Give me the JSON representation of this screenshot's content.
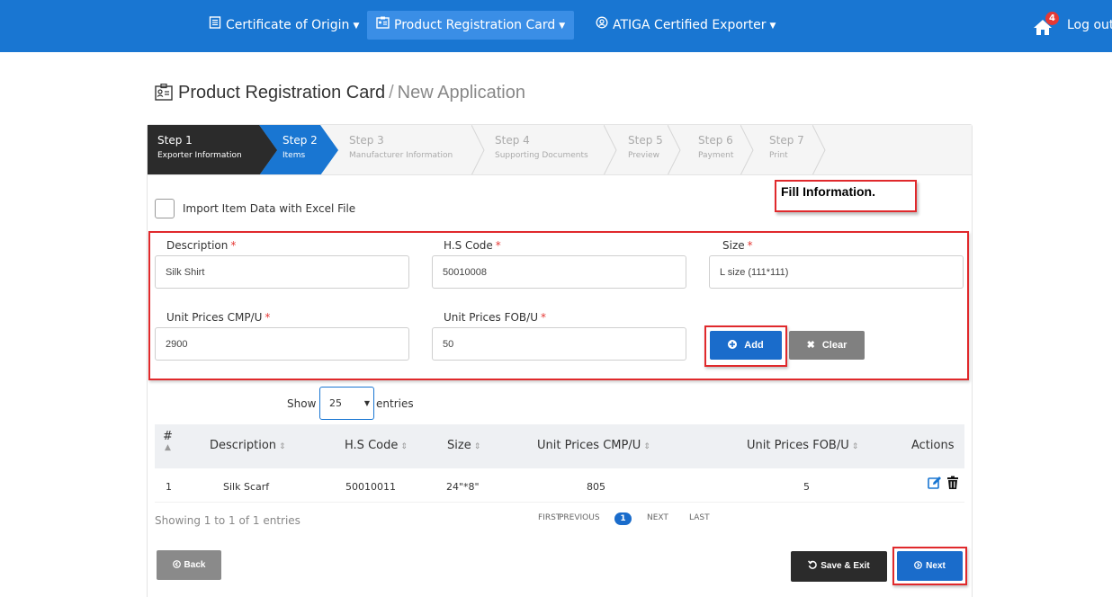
{
  "nav": {
    "certificate": "Certificate of Origin",
    "product_card": "Product Registration Card",
    "atiga": "ATIGA Certified Exporter",
    "notifications": "4",
    "logout": "Log out"
  },
  "page": {
    "title": "Product Registration Card",
    "separator": "/",
    "subtitle": "New Application"
  },
  "steps": [
    {
      "title": "Step 1",
      "sub": "Exporter Information",
      "state": "done"
    },
    {
      "title": "Step 2",
      "sub": "Items",
      "state": "current"
    },
    {
      "title": "Step 3",
      "sub": "Manufacturer Information",
      "state": "pending"
    },
    {
      "title": "Step 4",
      "sub": "Supporting Documents",
      "state": "pending"
    },
    {
      "title": "Step 5",
      "sub": "Preview",
      "state": "pending"
    },
    {
      "title": "Step 6",
      "sub": "Payment",
      "state": "pending"
    },
    {
      "title": "Step 7",
      "sub": "Print",
      "state": "pending"
    }
  ],
  "import_label": "Import Item Data with Excel File",
  "callout": "Fill Information.",
  "form": {
    "description_label": "Description",
    "description_value": "Silk Shirt",
    "hs_label": "H.S Code",
    "hs_value": "50010008",
    "size_label": "Size",
    "size_value": "L size (111*111)",
    "cmp_label": "Unit Prices CMP/U",
    "cmp_value": "2900",
    "fob_label": "Unit Prices FOB/U",
    "fob_value": "50",
    "required": "*",
    "add": "Add",
    "clear": "Clear"
  },
  "table": {
    "show": "Show",
    "page_size": "25",
    "entries": "entries",
    "headers": [
      "#",
      "Description",
      "H.S Code",
      "Size",
      "Unit Prices CMP/U",
      "Unit Prices FOB/U",
      "Actions"
    ],
    "rows": [
      [
        "1",
        "Silk Scarf",
        "50010011",
        "24\"*8\"",
        "805",
        "5"
      ]
    ],
    "showing": "Showing 1 to 1 of 1 entries",
    "pager": {
      "first": "FIRST",
      "previous": "PREVIOUS",
      "current": "1",
      "next": "NEXT",
      "last": "LAST"
    }
  },
  "buttons": {
    "back": "Back",
    "save_exit": "Save & Exit",
    "next": "Next"
  },
  "colors": {
    "nav_blue": "#1976d2",
    "primary": "#1a6ccb",
    "highlight_red": "#e0292c",
    "dark": "#2b2b2b",
    "gray": "#808080"
  }
}
